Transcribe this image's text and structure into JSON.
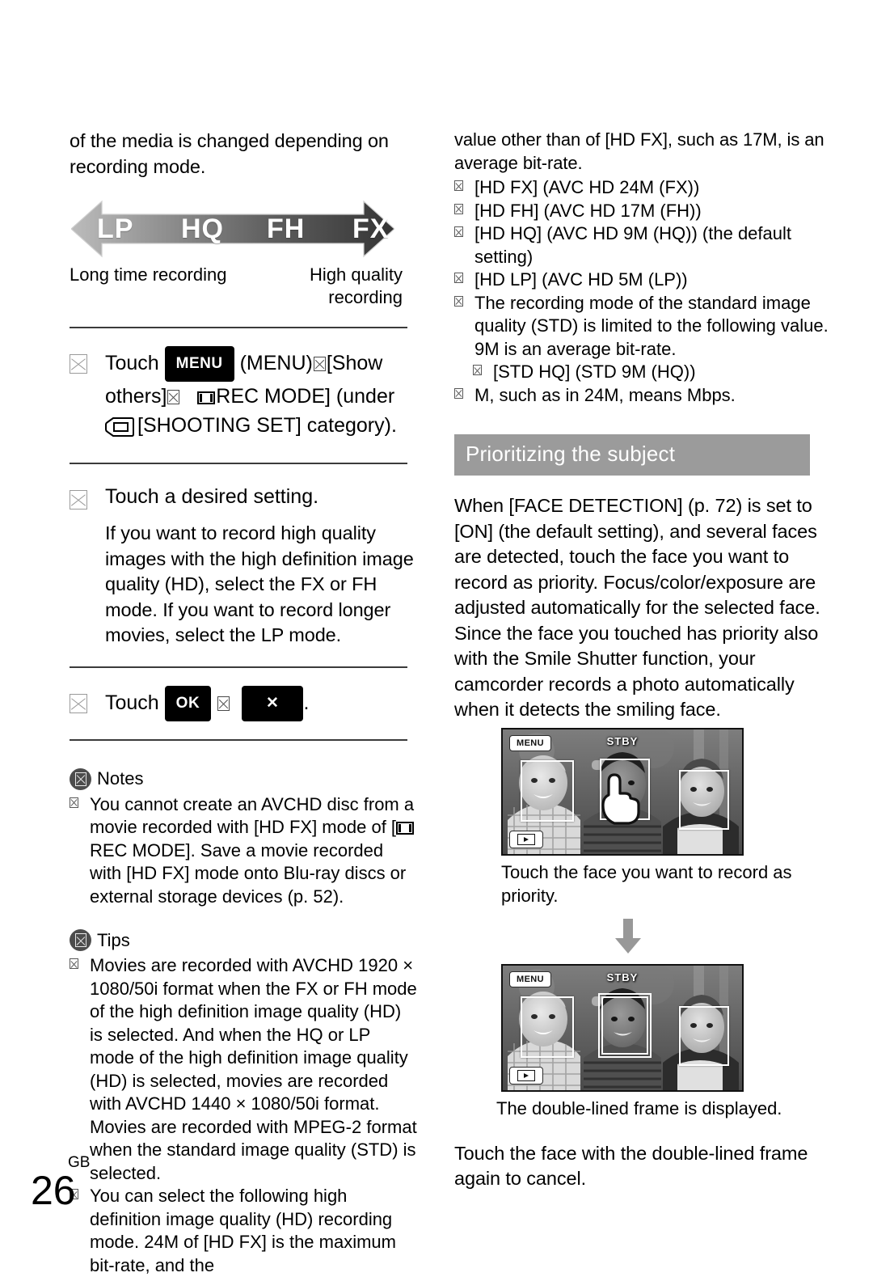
{
  "page": {
    "locale_label": "GB",
    "number": "26"
  },
  "left_column": {
    "intro_paragraph": "of the media is changed depending on recording mode.",
    "mode_arrow": {
      "modes": [
        "LP",
        "HQ",
        "FH",
        "FX"
      ],
      "caption_left": "Long time recording",
      "caption_right": "High quality recording",
      "gradient_from": "#b4b4b4",
      "gradient_to": "#3a3a3a"
    },
    "steps": [
      {
        "text_a": "Touch",
        "menu_button_label": "MENU",
        "text_b": "(MENU)",
        "text_c": "[Show others]",
        "text_d": "[",
        "rec_mode_label": "REC MODE] (under",
        "text_e": "[SHOOTING SET] category)."
      },
      {
        "heading": "Touch a desired setting.",
        "body": "If you want to record high quality images with the high definition image quality (HD), select the FX or FH mode. If you want to record longer movies, select the LP mode."
      },
      {
        "text_a": "Touch",
        "ok_button_label": "OK",
        "close_button_label": "✕",
        "text_b": "."
      }
    ],
    "notes": {
      "title": "Notes",
      "items": [
        "You cannot create an AVCHD disc from a movie recorded with [HD FX] mode of [",
        "REC MODE]. Save a movie recorded with [HD FX] mode onto Blu-ray discs or external storage devices (p. 52)."
      ]
    },
    "tips": {
      "title": "Tips",
      "items": [
        "Movies are recorded with AVCHD 1920 × 1080/50i format when the FX or FH mode of the high definition image quality (HD) is selected. And when the HQ or LP mode of the high definition image quality (HD) is selected, movies are recorded with AVCHD 1440 × 1080/50i format. Movies are recorded with MPEG-2 format when the standard image quality (STD) is selected.",
        "You can select the following high definition image quality (HD) recording mode. 24M of [HD FX] is the maximum bit-rate, and the"
      ]
    }
  },
  "right_column": {
    "continued_paragraph": "value other than of [HD FX], such as 17M, is an average bit-rate.",
    "bitrate_list": [
      "[HD FX] (AVC HD 24M (FX))",
      "[HD FH] (AVC HD 17M (FH))",
      "[HD HQ] (AVC HD 9M (HQ)) (the default setting)",
      "[HD LP] (AVC HD 5M (LP))"
    ],
    "std_note": "The recording mode of the standard image quality (STD) is limited to the following value. 9M is an average bit-rate.",
    "std_list": [
      "[STD HQ] (STD 9M (HQ))"
    ],
    "mbps_note": "M, such as in 24M, means Mbps.",
    "section_heading": "Prioritizing the subject",
    "section_body": "When [FACE DETECTION] (p. 72) is set to [ON] (the default setting), and several faces are detected, touch the face you want to record as priority. Focus/color/exposure are adjusted automatically for the selected face. Since the face you touched has priority also with the Smile Shutter function, your camcorder records a photo automatically when it detects the smiling face.",
    "screenshot_1": {
      "menu_label": "MENU",
      "status_label": "STBY",
      "caption": "Touch the face you want to record as priority."
    },
    "screenshot_2": {
      "menu_label": "MENU",
      "status_label": "STBY",
      "caption": "The double-lined frame is displayed."
    },
    "closing_paragraph": "Touch the face with the double-lined frame again to cancel."
  }
}
